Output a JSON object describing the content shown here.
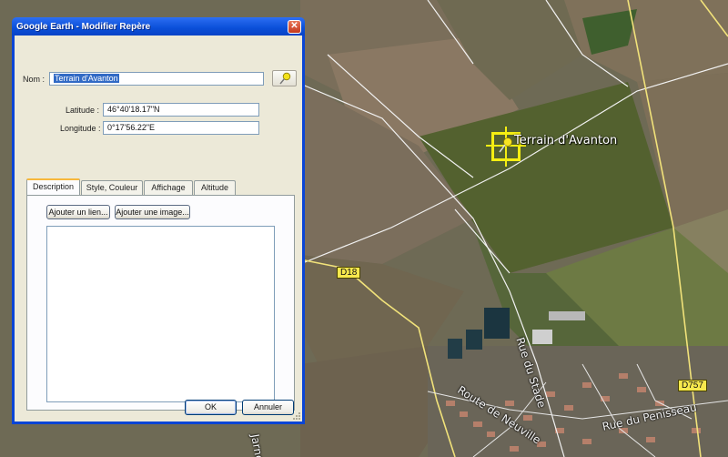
{
  "window": {
    "title": "Google Earth - Modifier Repère",
    "close_glyph": "✕"
  },
  "form": {
    "name_label": "Nom :",
    "name_value": "Terrain d'Avanton",
    "latitude_label": "Latitude :",
    "latitude_value": "46°40'18.17\"N",
    "longitude_label": "Longitude :",
    "longitude_value": "0°17'56.22\"E"
  },
  "tabs": [
    {
      "label": "Description",
      "active": true
    },
    {
      "label": "Style, Couleur",
      "active": false
    },
    {
      "label": "Affichage",
      "active": false
    },
    {
      "label": "Altitude",
      "active": false
    }
  ],
  "description": {
    "add_link_label": "Ajouter un lien...",
    "add_image_label": "Ajouter une image...",
    "text": ""
  },
  "footer": {
    "ok_label": "OK",
    "cancel_label": "Annuler"
  },
  "map": {
    "placemark_label": "Terrain d'Avanton",
    "road_labels": {
      "d18": "D18",
      "d757": "D757"
    },
    "street_labels": {
      "rue_du_stade": "Rue du Stade",
      "route_de_neuville": "Route de Neuville",
      "rue_du_penisseau": "Rue du Penisseau",
      "partial_street": "Jarnet"
    }
  },
  "colors": {
    "title_bar": "#0a4fd8",
    "dialog_face": "#ece9d8",
    "placemark_yellow": "#f5ee12",
    "road_sign_yellow": "#f7e94d"
  },
  "icons": {
    "placemark_button": "yellow-pushpin-icon",
    "placemark_on_map": "yellow-pushpin-icon"
  }
}
